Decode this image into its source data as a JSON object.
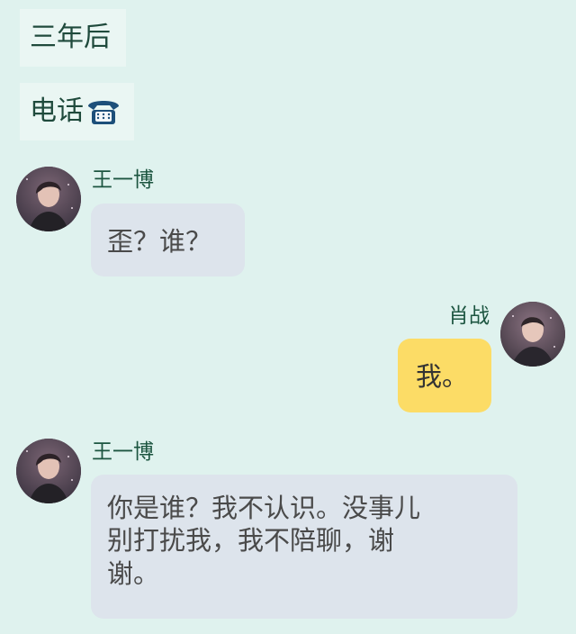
{
  "notes": {
    "time_note": "三年后",
    "call_note": "电话",
    "call_icon": "telephone-icon"
  },
  "messages": [
    {
      "side": "left",
      "sender": "王一博",
      "text": "歪？谁？"
    },
    {
      "side": "right",
      "sender": "肖战",
      "text": "我。"
    },
    {
      "side": "left",
      "sender": "王一博",
      "text": "你是谁？我不认识。没事儿\n别打扰我，我不陪聊，谢\n谢。"
    }
  ],
  "colors": {
    "background": "#dff2ee",
    "left_bubble": "#dde4ec",
    "right_bubble": "#fcdc66",
    "sender_name": "#1c5540"
  }
}
